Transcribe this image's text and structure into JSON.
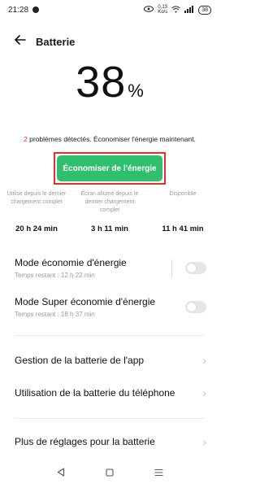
{
  "status_bar": {
    "time": "21:28",
    "net_speed_top": "0,13",
    "net_speed_bottom": "Ko/s",
    "battery": "38"
  },
  "header": {
    "title": "Batterie"
  },
  "battery": {
    "level": "38",
    "unit": "%"
  },
  "issues": {
    "count": "2",
    "text": " problèmes détectés. Économiser l'énergie maintenant."
  },
  "save_button": {
    "label": "Économiser de l'énergie",
    "accent": "#2fbf6e",
    "highlight": "#e4302a"
  },
  "stats": [
    {
      "label": "Utilisé depuis le dernier chargement complet",
      "value": "20 h 24 min"
    },
    {
      "label": "Écran allumé depuis le dernier chargement complet",
      "value": "3 h 11 min"
    },
    {
      "label": "Disponible",
      "value": "11 h 41 min"
    }
  ],
  "modes": [
    {
      "title": "Mode économie d'énergie",
      "subtitle": "Temps restant : 12 h 22 min",
      "enabled": false
    },
    {
      "title": "Mode Super économie d'énergie",
      "subtitle": "Temps restant : 18 h 37 min",
      "enabled": false
    }
  ],
  "menu": [
    {
      "label": "Gestion de la batterie de l'app"
    },
    {
      "label": "Utilisation de la batterie du téléphone"
    },
    {
      "label": "Plus de réglages pour la batterie"
    }
  ],
  "icons": {
    "back": "arrow-left-icon",
    "chevron": "chevron-right-icon",
    "nav_back": "triangle-back-icon",
    "nav_home": "square-home-icon",
    "nav_menu": "lines-menu-icon"
  }
}
